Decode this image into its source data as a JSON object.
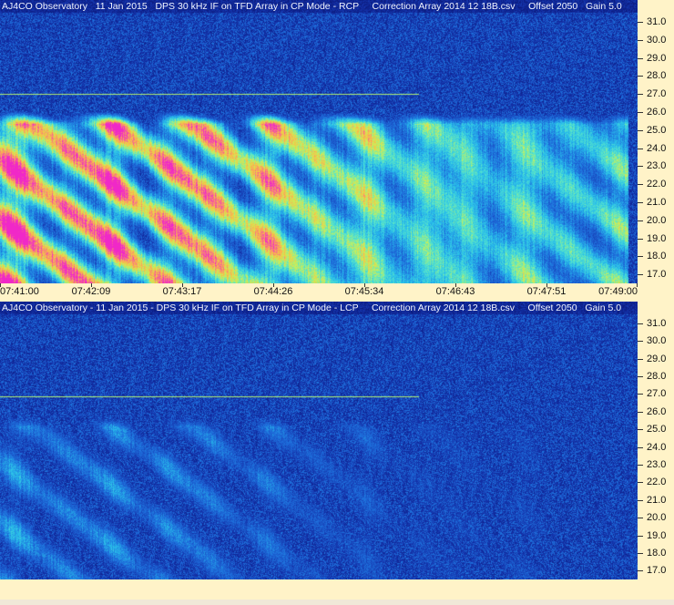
{
  "chart_data": [
    {
      "type": "heatmap",
      "title": "AJ4CO Observatory   11 Jan 2015   DPS 30 kHz IF on TFD Array in CP Mode - RCP     Correction Array 2014 12 18B.csv     Offset 2050   Gain 5.0",
      "x_ticks": [
        "07:41:00",
        "07:42:09",
        "07:43:17",
        "07:44:26",
        "07:45:34",
        "07:46:43",
        "07:47:51",
        "07:49:00"
      ],
      "y_ticks": [
        "31.0",
        "30.0",
        "29.0",
        "28.0",
        "27.0",
        "26.0",
        "25.0",
        "24.0",
        "23.0",
        "22.0",
        "21.0",
        "20.0",
        "19.0",
        "18.0",
        "17.0"
      ],
      "y_range": [
        16.5,
        31.5
      ],
      "polarization": "RCP",
      "intensity": "strong"
    },
    {
      "type": "heatmap",
      "title": "AJ4CO Observatory - 11 Jan 2015 - DPS 30 kHz IF on TFD Array in CP Mode - LCP     Correction Array 2014 12 18B.csv     Offset 2050   Gain 5.0",
      "y_ticks": [
        "31.0",
        "30.0",
        "29.0",
        "28.0",
        "27.0",
        "26.0",
        "25.0",
        "24.0",
        "23.0",
        "22.0",
        "21.0",
        "20.0",
        "19.0",
        "18.0",
        "17.0"
      ],
      "y_range": [
        16.5,
        31.5
      ],
      "polarization": "LCP",
      "intensity": "weak"
    }
  ],
  "colors": {
    "background": "#fff3c8",
    "noise": "#1a2f9a"
  }
}
